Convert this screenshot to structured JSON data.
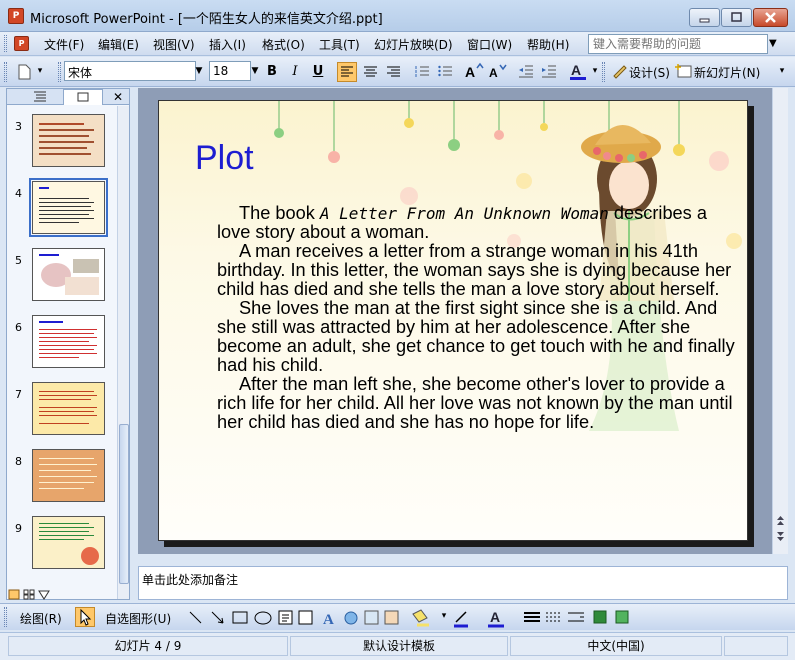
{
  "window": {
    "title": "Microsoft PowerPoint - [一个陌生女人的来信英文介绍.ppt]",
    "icon_label": "P"
  },
  "menu": {
    "items": [
      "文件(F)",
      "编辑(E)",
      "视图(V)",
      "插入(I)",
      "格式(O)",
      "工具(T)",
      "幻灯片放映(D)",
      "窗口(W)",
      "帮助(H)"
    ],
    "help_placeholder": "键入需要帮助的问题"
  },
  "format_toolbar": {
    "font_name": "宋体",
    "font_size": "18",
    "bold": "B",
    "italic": "I",
    "underline": "U",
    "design_label": "设计(S)",
    "new_slide_label": "新幻灯片(N)"
  },
  "slide_pane": {
    "thumbnails": [
      {
        "num": "3",
        "bg": "#f4dfc5"
      },
      {
        "num": "4",
        "bg": "#fff8e2",
        "selected": true
      },
      {
        "num": "5",
        "bg": "#ffffff"
      },
      {
        "num": "6",
        "bg": "#ffffff"
      },
      {
        "num": "7",
        "bg": "#fce9a8"
      },
      {
        "num": "8",
        "bg": "#e7a56b"
      },
      {
        "num": "9",
        "bg": "#fbf0c8"
      }
    ]
  },
  "slide": {
    "title": "Plot",
    "p1_prefix": "The book ",
    "p1_book": "A Letter From An Unknown Woman",
    "p1_suffix": " describes a love story about a woman.",
    "p2": "A man receives a letter from a strange woman in his 41th birthday. In this letter, the woman says she is dying because her child has died and she tells the man a love story about herself.",
    "p3": "She loves the man at the first sight since she is a child. And she still was attracted by him at her adolescence. After she become an adult, she get chance to get touch with he and finally had his child.",
    "p4": "After the man left she, she become other's lover to provide a rich life for her child. All her love was not known by the man until her child has died and she has no hope for life."
  },
  "notes": {
    "placeholder": "单击此处添加备注"
  },
  "drawing_toolbar": {
    "draw_label": "绘图(R)",
    "autoshapes_label": "自选图形(U)"
  },
  "status": {
    "slide_info": "幻灯片 4 / 9",
    "template": "默认设计模板",
    "language": "中文(中国)"
  },
  "colors": {
    "title_blue": "#1d1dd1",
    "chrome_blue": "#c9dcf2",
    "active_button": "#ffc86a"
  }
}
